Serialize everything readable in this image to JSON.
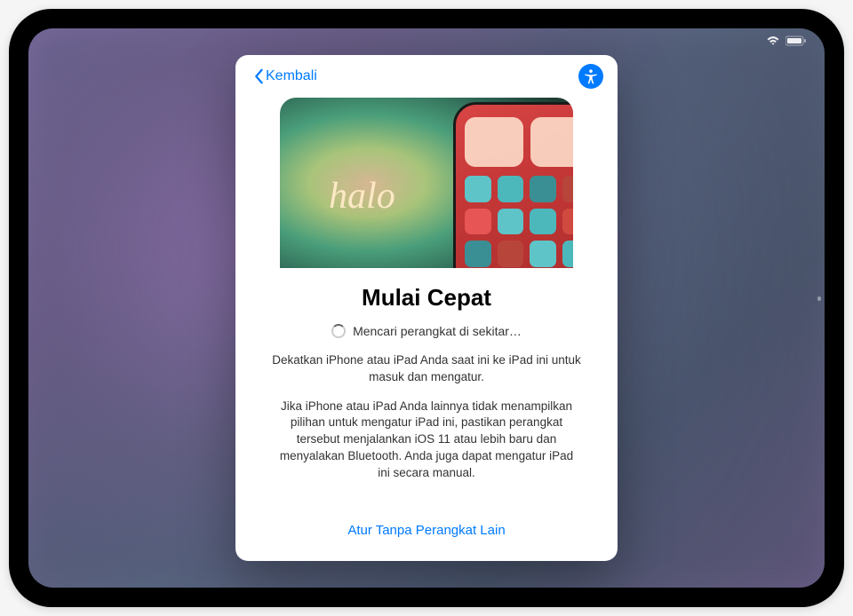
{
  "header": {
    "back_label": "Kembali"
  },
  "hero": {
    "halo_text": "halo"
  },
  "content": {
    "title": "Mulai Cepat",
    "searching_text": "Mencari perangkat di sekitar…",
    "instruction": "Dekatkan iPhone atau iPad Anda saat ini ke iPad ini untuk masuk dan mengatur.",
    "help": "Jika iPhone atau iPad Anda lainnya tidak menampilkan pilihan untuk mengatur iPad ini, pastikan perangkat tersebut menjalankan iOS 11 atau lebih baru dan menyalakan Bluetooth. Anda juga dapat mengatur iPad ini secara manual."
  },
  "footer": {
    "manual_label": "Atur Tanpa Perangkat Lain"
  },
  "phone_apps": [
    "#5ec4c8",
    "#4db8bc",
    "#3a8f94",
    "#b8453a",
    "#e85555",
    "#5ec4c8",
    "#4db8bc",
    "#d14a40",
    "#3a8f94",
    "#b8453a",
    "#5ec4c8",
    "#4db8bc"
  ]
}
